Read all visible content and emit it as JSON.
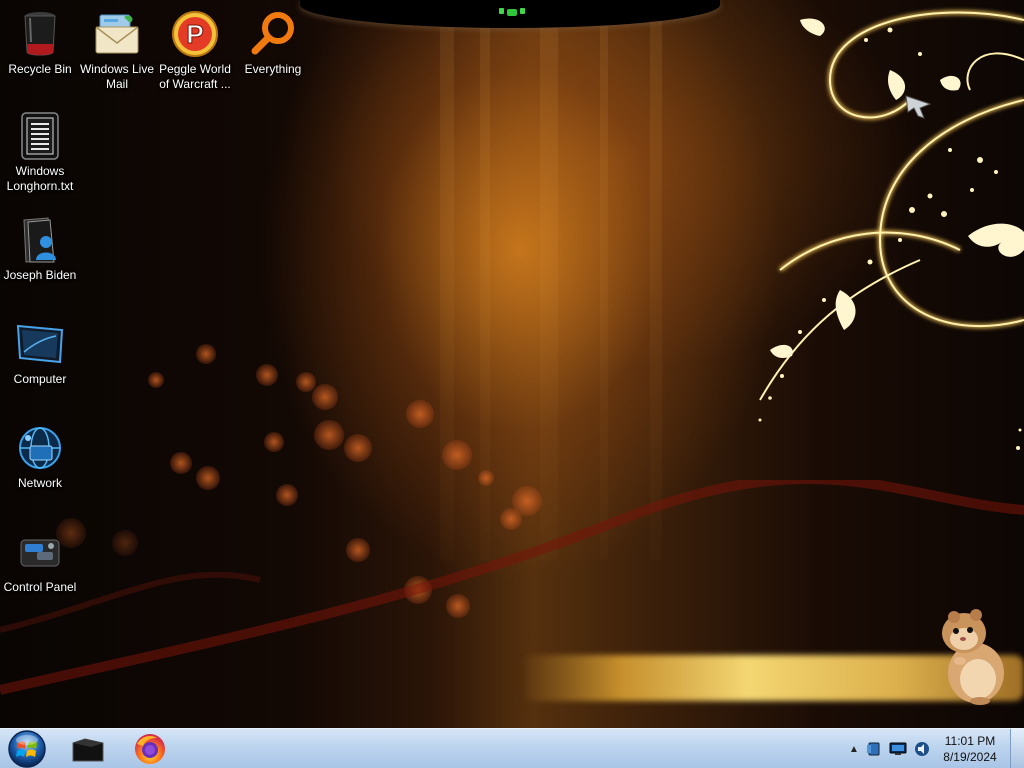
{
  "desktop": {
    "icons": [
      {
        "name": "recycle-bin",
        "label": "Recycle Bin",
        "icon": "recycle-bin-icon"
      },
      {
        "name": "windows-live-mail",
        "label": "Windows Live\nMail",
        "icon": "mail-icon"
      },
      {
        "name": "peggle-world-of-warcraft",
        "label": "Peggle World\nof Warcraft ...",
        "icon": "peggle-icon"
      },
      {
        "name": "everything",
        "label": "Everything",
        "icon": "magnifier-icon"
      },
      {
        "name": "windows-longhorn-txt",
        "label": "Windows\nLonghorn.txt",
        "icon": "text-file-icon"
      },
      {
        "name": "joseph-biden",
        "label": "Joseph Biden",
        "icon": "user-folder-icon"
      },
      {
        "name": "computer",
        "label": "Computer",
        "icon": "monitor-icon"
      },
      {
        "name": "network",
        "label": "Network",
        "icon": "network-globe-icon"
      },
      {
        "name": "control-panel",
        "label": "Control Panel",
        "icon": "control-panel-icon"
      }
    ]
  },
  "taskbar": {
    "start_icon": "windows-orb-icon",
    "pinned": [
      {
        "name": "explorer",
        "icon": "folder-icon"
      },
      {
        "name": "firefox",
        "icon": "firefox-icon"
      }
    ],
    "tray": {
      "expand_glyph": "▲",
      "icons": [
        "action-center-icon",
        "network-status-icon",
        "volume-icon"
      ],
      "time": "11:01 PM",
      "date": "8/19/2024"
    }
  },
  "colors": {
    "taskbar_top": "#d6e6f7",
    "taskbar_bottom": "#a9c5e6",
    "wallpaper_glow": "#d6801e",
    "icon_label": "#ffffff"
  }
}
